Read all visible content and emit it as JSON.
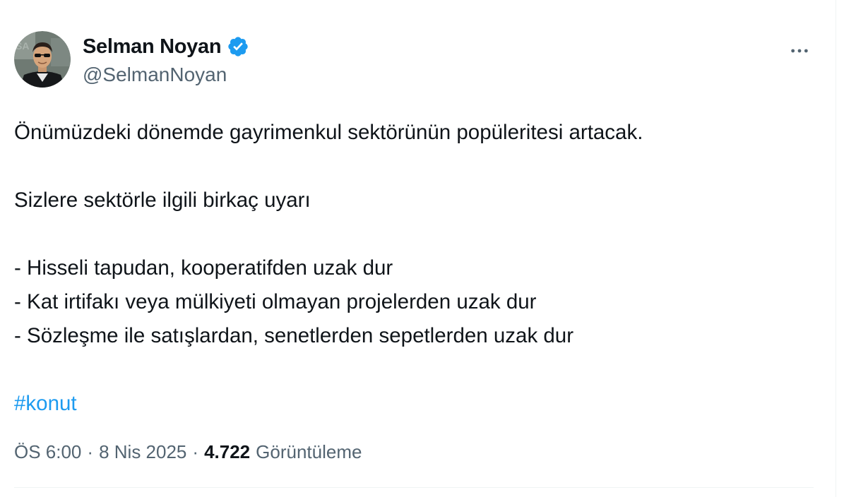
{
  "author": {
    "display_name": "Selman Noyan",
    "handle": "@SelmanNoyan",
    "verified_icon": "verified-badge-icon",
    "verified_color": "#1d9bf0"
  },
  "tweet": {
    "lines": [
      "Önümüzdeki dönemde gayrimenkul sektörünün popüleritesi artacak.",
      "",
      "Sizlere sektörle ilgili birkaç uyarı",
      "",
      "- Hisseli tapudan, kooperatifden uzak dur",
      "- Kat irtifakı veya mülkiyeti olmayan projelerden uzak dur",
      "- Sözleşme ile satışlardan, senetlerden sepetlerden uzak dur",
      ""
    ],
    "hashtag": "#konut"
  },
  "meta": {
    "time": "ÖS 6:00",
    "separator": "·",
    "date": "8 Nis 2025",
    "views_count": "4.722",
    "views_label": "Görüntüleme"
  },
  "colors": {
    "text": "#0f1419",
    "secondary": "#536471",
    "link": "#1d9bf0",
    "divider": "#eff3f4"
  }
}
